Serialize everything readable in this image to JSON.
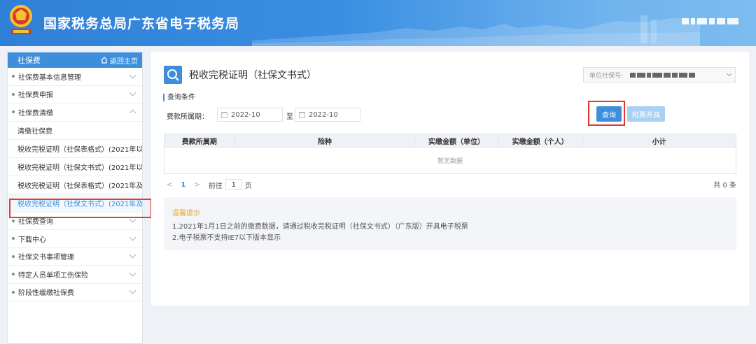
{
  "header": {
    "title": "国家税务总局广东省电子税务局"
  },
  "sidebar": {
    "section_title": "社保费",
    "home_label": "返回主页",
    "items": [
      {
        "label": "社保费基本信息管理"
      },
      {
        "label": "社保费申报"
      },
      {
        "label": "社保费清缴"
      }
    ],
    "sub_items": [
      {
        "label": "清缴社保费"
      },
      {
        "label": "税收完税证明（社保表格式）(2021年以前"
      },
      {
        "label": "税收完税证明（社保文书式）(2021年以前"
      },
      {
        "label": "税收完税证明（社保表格式）(2021年及以"
      },
      {
        "label": "税收完税证明（社保文书式）(2021年及以"
      }
    ],
    "items_after": [
      {
        "label": "社保费查询"
      },
      {
        "label": "下载中心"
      },
      {
        "label": "社保文书事项管理"
      },
      {
        "label": "特定人员单项工伤保险"
      },
      {
        "label": "阶段性缓缴社保费"
      }
    ]
  },
  "main": {
    "page_title": "税收完税证明（社保文书式）",
    "unit_label": "单位社保号:",
    "section_label": "查询条件",
    "period_label": "费款所属期：",
    "date_from": "2022-10",
    "to_label": "至",
    "date_to": "2022-10",
    "query_button": "查询",
    "invoice_button": "税票开具",
    "table": {
      "headers": [
        "费款所属期",
        "险种",
        "实缴金额（单位）",
        "实缴金额（个人）",
        "小计"
      ],
      "empty_text": "暂无数据"
    },
    "pager": {
      "prev": "<",
      "current_page": "1",
      "next": ">",
      "goto_label": "前往",
      "goto_value": "1",
      "page_suffix": "页",
      "total": "共 0 条"
    },
    "tips": {
      "title": "温馨提示",
      "lines": [
        "1.2021年1月1日之前的缴费数据，请通过税收完税证明（社保文书式）（广东版）开具电子税票",
        "2.电子税票不支持IE7以下版本显示"
      ]
    }
  },
  "colors": {
    "accent": "#3d8fdc",
    "highlight_border": "#e6382c",
    "tip_title": "#f0a020"
  }
}
